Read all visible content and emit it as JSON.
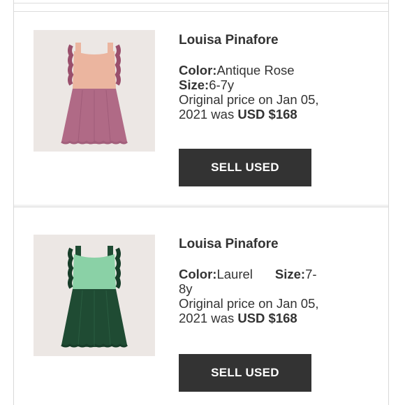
{
  "items": [
    {
      "title": "Louisa Pinafore",
      "color_label": "Color:",
      "color_value": "Antique Rose",
      "size_label": "Size:",
      "size_value": "6-7y",
      "price_text_1": "Original price on Jan 05,",
      "price_text_2": "2021 was ",
      "price_value": "USD $168",
      "button_label": "SELL USED",
      "colors": {
        "bodice": "#ebb59f",
        "skirt": "#b06a86",
        "ruffle": "#9a4f6c",
        "bg": "#ece7e4"
      }
    },
    {
      "title": "Louisa Pinafore",
      "color_label": "Color:",
      "color_value": "Laurel",
      "size_label": "Size:",
      "size_value_1": "7-",
      "size_value_2": "8y",
      "price_text_1": "Original price on Jan 05,",
      "price_text_2": "2021 was ",
      "price_value": "USD $168",
      "button_label": "SELL USED",
      "colors": {
        "bodice": "#8ad1a6",
        "skirt": "#1f4b33",
        "ruffle": "#173d29",
        "bg": "#ece7e4"
      }
    }
  ],
  "button_color": "#333333"
}
